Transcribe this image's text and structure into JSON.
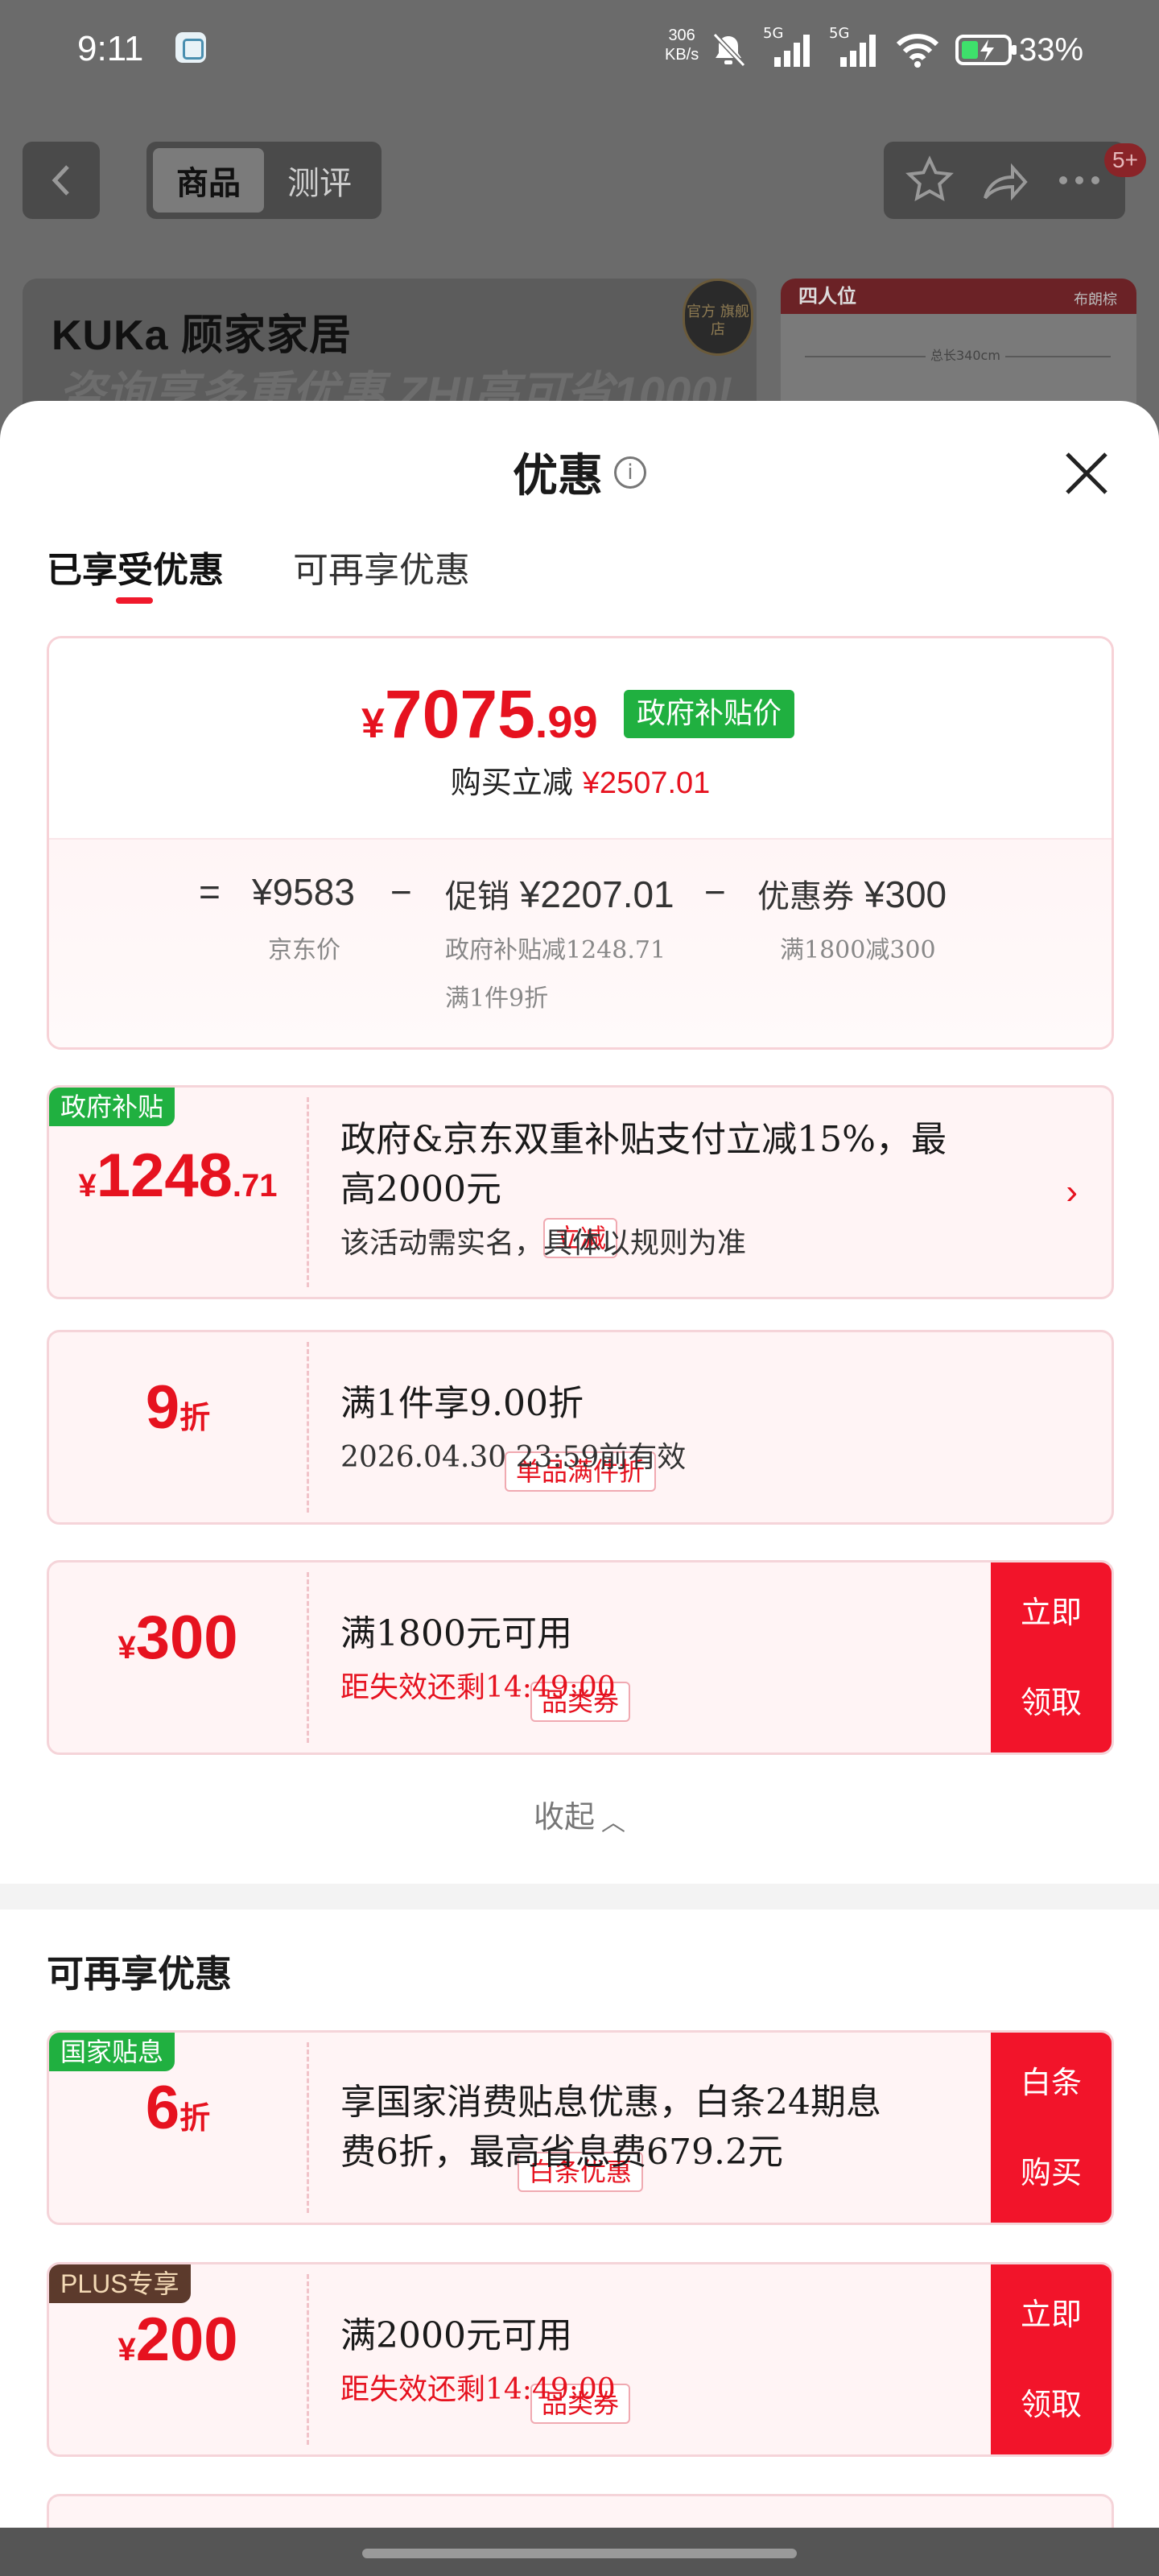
{
  "status_bar": {
    "time": "9:11",
    "net_speed_value": "306",
    "net_speed_unit": "KB/s",
    "signal1": "5G",
    "signal2": "5G",
    "battery_pct": "33%"
  },
  "product_nav": {
    "tabs": [
      "商品",
      "测评"
    ],
    "cart_badge": "5+"
  },
  "banner": {
    "brand": "KUKa 顾家家居",
    "sub": "咨询享多重优惠 ZHI高可省1000!",
    "seal": "官方 旗舰店",
    "side_card_title": "四人位",
    "side_card_tag": "布朗棕",
    "side_card_dim": "总长340cm"
  },
  "sheet": {
    "title": "优惠",
    "tabs": [
      "已享受优惠",
      "可再享优惠"
    ]
  },
  "summary": {
    "currency": "¥",
    "final_int": "7075",
    "final_dec": ".99",
    "gov_tag": "政府补贴价",
    "cut_label": "购买立减",
    "cut_amount": "¥2507.01",
    "equals": "=",
    "jd_price": "¥9583",
    "minus": "−",
    "promo_label": "促销",
    "promo_amount": "¥2207.01",
    "coupon_label": "优惠券",
    "coupon_amount": "¥300",
    "jd_price_label": "京东价",
    "promo_note1": "政府补贴减1248.71",
    "promo_note2": "满1件9折",
    "coupon_note": "满1800减300"
  },
  "enjoyed": [
    {
      "tag": "政府补贴",
      "amount_sym": "¥",
      "amount_int": "1248",
      "amount_dec": ".71",
      "label": "立减",
      "main_line1": "政府&京东双重补贴支付立减15%，最",
      "main_line2": "高2000元",
      "sub": "该活动需实名，具体以规则为准",
      "arrow": "›"
    },
    {
      "amount_int": "9",
      "amount_unit": "折",
      "label": "单品满件折",
      "main": "满1件享9.00折",
      "sub": "2026.04.30 23:59前有效"
    },
    {
      "amount_sym": "¥",
      "amount_int": "300",
      "label": "品类券",
      "main": "满1800元可用",
      "sub": "距失效还剩14:49:00",
      "action_1": "立即",
      "action_2": "领取"
    }
  ],
  "collapse_label": "收起",
  "more_title": "可再享优惠",
  "more": [
    {
      "tag": "国家贴息",
      "amount_int": "6",
      "amount_unit": "折",
      "label": "白条优惠",
      "main_line1": "享国家消费贴息优惠，白条24期息",
      "main_line2": "费6折，最高省息费679.2元",
      "action_1": "白条",
      "action_2": "购买"
    },
    {
      "tag": "PLUS专享",
      "amount_sym": "¥",
      "amount_int": "200",
      "label": "品类券",
      "main": "满2000元可用",
      "sub": "距失效还剩14:49:00",
      "action_1": "立即",
      "action_2": "领取"
    }
  ],
  "colors": {
    "accent_red": "#e6121f",
    "gov_green": "#20b040",
    "plus_brown": "#5c3a2c",
    "card_bg": "#fff4f5"
  }
}
